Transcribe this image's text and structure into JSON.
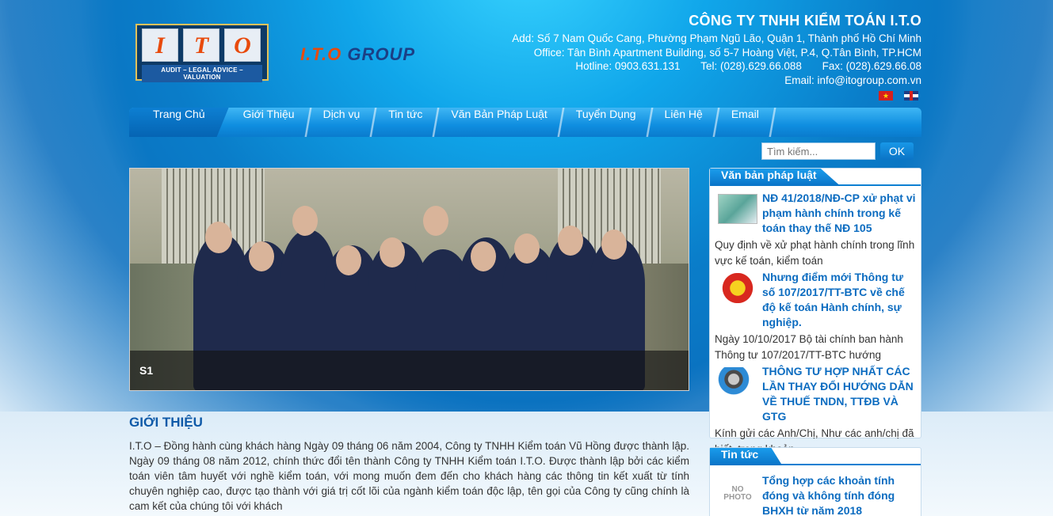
{
  "header": {
    "logo_letters": [
      "I",
      "T",
      "O"
    ],
    "logo_tagline": "AUDIT – LEGAL ADVICE – VALUATION",
    "group_logo_ito": "I.T.O",
    "group_logo_text": "GROUP",
    "company_name": "CÔNG TY TNHH KIỂM TOÁN I.T.O",
    "address": "Add: Số 7 Nam Quốc Cang, Phường Phạm Ngũ Lão, Quận 1, Thành phố Hồ Chí Minh",
    "office": "Office: Tân Bình Apartment Building, số 5-7 Hoàng Việt, P.4, Q.Tân Bình, TP.HCM",
    "hotline": "Hotline: 0903.631.131",
    "tel": "Tel: (028).629.66.088",
    "fax": "Fax: (028).629.66.08",
    "email": "Email: info@itogroup.com.vn",
    "flag_vn_star": "★"
  },
  "nav": {
    "items": [
      "Trang Chủ",
      "Giới Thiệu",
      "Dịch vụ",
      "Tin tức",
      "Văn Bản Pháp Luật",
      "Tuyển Dụng",
      "Liên Hệ",
      "Email"
    ]
  },
  "search": {
    "placeholder": "Tìm kiếm...",
    "button": "OK"
  },
  "slider": {
    "caption": "S1"
  },
  "intro": {
    "title": "GIỚI THIỆU",
    "text": "I.T.O – Đồng hành cùng khách hàng Ngày 09 tháng 06 năm 2004, Công ty TNHH Kiểm toán Vũ Hồng được thành lập. Ngày 09 tháng 08 năm 2012, chính thức đổi tên thành Công ty TNHH Kiểm toán I.T.O. Được thành lập bởi các kiểm toán viên tâm huyết với nghề kiểm toán, với mong muốn đem đến cho khách hàng các thông tin kết xuất từ tính chuyên nghiệp cao, được tạo thành với giá trị cốt lõi của ngành kiểm toán độc lập, tên gọi của Công ty cũng chính là cam kết của chúng tôi với khách"
  },
  "sidebar": {
    "legal": {
      "title": "Văn bản pháp luật",
      "items": [
        {
          "title": "NĐ 41/2018/NĐ-CP xử phạt vi phạm hành chính trong kế toán thay thế NĐ 105",
          "summary": "Quy định về xử phạt hành chính trong lĩnh vực kế toán, kiểm toán"
        },
        {
          "title": "Nhưng điểm mới Thông tư số 107/2017/TT-BTC về chế độ kế toán Hành chính, sự nghiệp.",
          "summary": "Ngày 10/10/2017 Bộ tài chính ban hành Thông tư 107/2017/TT-BTC hướng"
        },
        {
          "title": "THÔNG TƯ HỢP NHẤT CÁC LẦN THAY ĐỔI HƯỚNG DẪN VỀ THUẾ TNDN, TTĐB VÀ GTG",
          "summary": "Kính gửi các Anh/Chị,   Như các anh/chị đã biết, trong khoản"
        }
      ]
    },
    "news": {
      "title": "Tin tức",
      "no_photo": "NO PHOTO",
      "items": [
        {
          "title": "Tổng hợp các khoản tính đóng và không tính đóng BHXH từ năm 2018"
        }
      ]
    }
  }
}
